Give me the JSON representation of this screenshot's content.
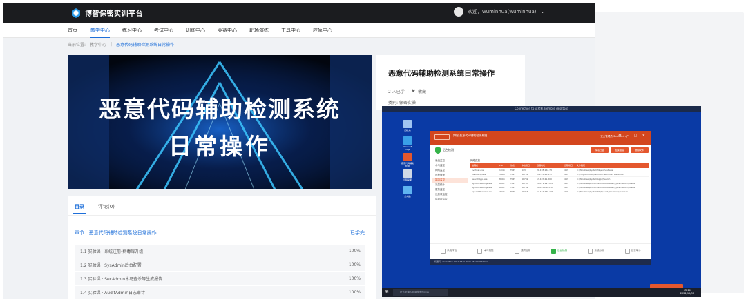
{
  "app": {
    "title": "博智保密实训平台",
    "user": "欢迎，wuminhua(wuminhua)"
  },
  "nav": {
    "items": [
      "首页",
      "教学中心",
      "练习中心",
      "考试中心",
      "训练中心",
      "竞赛中心",
      "靶场演练",
      "工具中心",
      "应急中心"
    ],
    "active_index": 1
  },
  "breadcrumb": {
    "items": [
      "当前位置:",
      "教学中心",
      "恶意代码辅助检测系统日常操作"
    ]
  },
  "hero": {
    "line1": "恶意代码辅助检测系统",
    "line2": "日常操作"
  },
  "course": {
    "title": "恶意代码辅助检测系统日常操作",
    "learners": "2 人已学",
    "favorite": "收藏",
    "category": "类别: 保密实操"
  },
  "tabs": {
    "catalog": "目录",
    "comments": "评论(0)"
  },
  "chapter": {
    "title": "章节1 恶意代码辅助检测系统日常操作",
    "status": "已学完"
  },
  "lessons": [
    {
      "label": "1.1 实验课 · 系统注册-病毒库升级",
      "progress": "100%"
    },
    {
      "label": "1.2 实验课 · SysAdmin后台配置",
      "progress": "100%"
    },
    {
      "label": "1.3 实验课 · SecAdmin木马查杀等生成报告",
      "progress": "100%"
    },
    {
      "label": "1.4 实验课 · AuditAdmin日志审计",
      "progress": "100%"
    }
  ],
  "screen": {
    "window_title": "Connection to 试验机 (remote desktop)",
    "app_name": "博智\n恶意代码辅助检测系统",
    "app_user": "安全管理员(SecAdmin)",
    "tool_label": "后台检测",
    "buttons": [
      "病毒扫描",
      "结束进程",
      "删除文件"
    ],
    "side_items": [
      "系统监控",
      "木马监控",
      "网络监控",
      "进程管理",
      "端口监控",
      "流量统计",
      "服务监控",
      "注册表监控",
      "启动项监控"
    ],
    "table_caption": "网络连接",
    "table_headers": [
      "进程名",
      "PID",
      "协议",
      "本地端口",
      "远程地址",
      "远程端口",
      "文件路径"
    ],
    "table_rows": [
      [
        "svchost.exe",
        "1044",
        "TCP",
        "443",
        "20.198.162.78",
        "443",
        "C:\\Windows\\System32\\svchost.exe"
      ],
      [
        "MsMpEng.exe",
        "3468",
        "TCP",
        "49701",
        "172.16.23.171",
        "443",
        "C:\\ProgramData\\Microsoft\\Windows Defender"
      ],
      [
        "SearchApp.exe",
        "8904",
        "TCP",
        "49732",
        "13.107.21.200",
        "443",
        "C:\\Windows\\SystemApps\\Search"
      ],
      [
        "SystemSettings.exe",
        "6892",
        "TCP",
        "49745",
        "204.79.197.222",
        "443",
        "C:\\Windows\\ImmersiveControlPanel\\SystemSettings.exe"
      ],
      [
        "SystemSettings.exe",
        "6892",
        "TCP",
        "49752",
        "104.208.203.89",
        "443",
        "C:\\Windows\\ImmersiveControlPanel\\SystemSettings.exe"
      ],
      [
        "SpeechRuntime.exe",
        "7276",
        "TCP",
        "49763",
        "52.167.249.196",
        "443",
        "C:\\Windows\\System32\\Speech_OneCore\\common"
      ]
    ],
    "bottom_items": [
      "系统体检",
      "木马扫描",
      "漏洞检测",
      "后台检测",
      "系统分析",
      "日志审计"
    ],
    "bottom_active": 3,
    "status": "机器码: 4C4C4544-0052-4810-8030-B5C04F533632",
    "search_placeholder": "在这里输入你要搜索的内容",
    "clock_time": "10:11",
    "clock_date": "2021/12/31",
    "desktop_icons": [
      "回收站",
      "Microsoft Edge",
      "恶意代码辅助检测",
      "远程桌面",
      "此电脑"
    ]
  },
  "colors": {
    "primary": "#1e6fd9",
    "topbar": "#1b1c1f",
    "app_accent": "#d3461e"
  }
}
